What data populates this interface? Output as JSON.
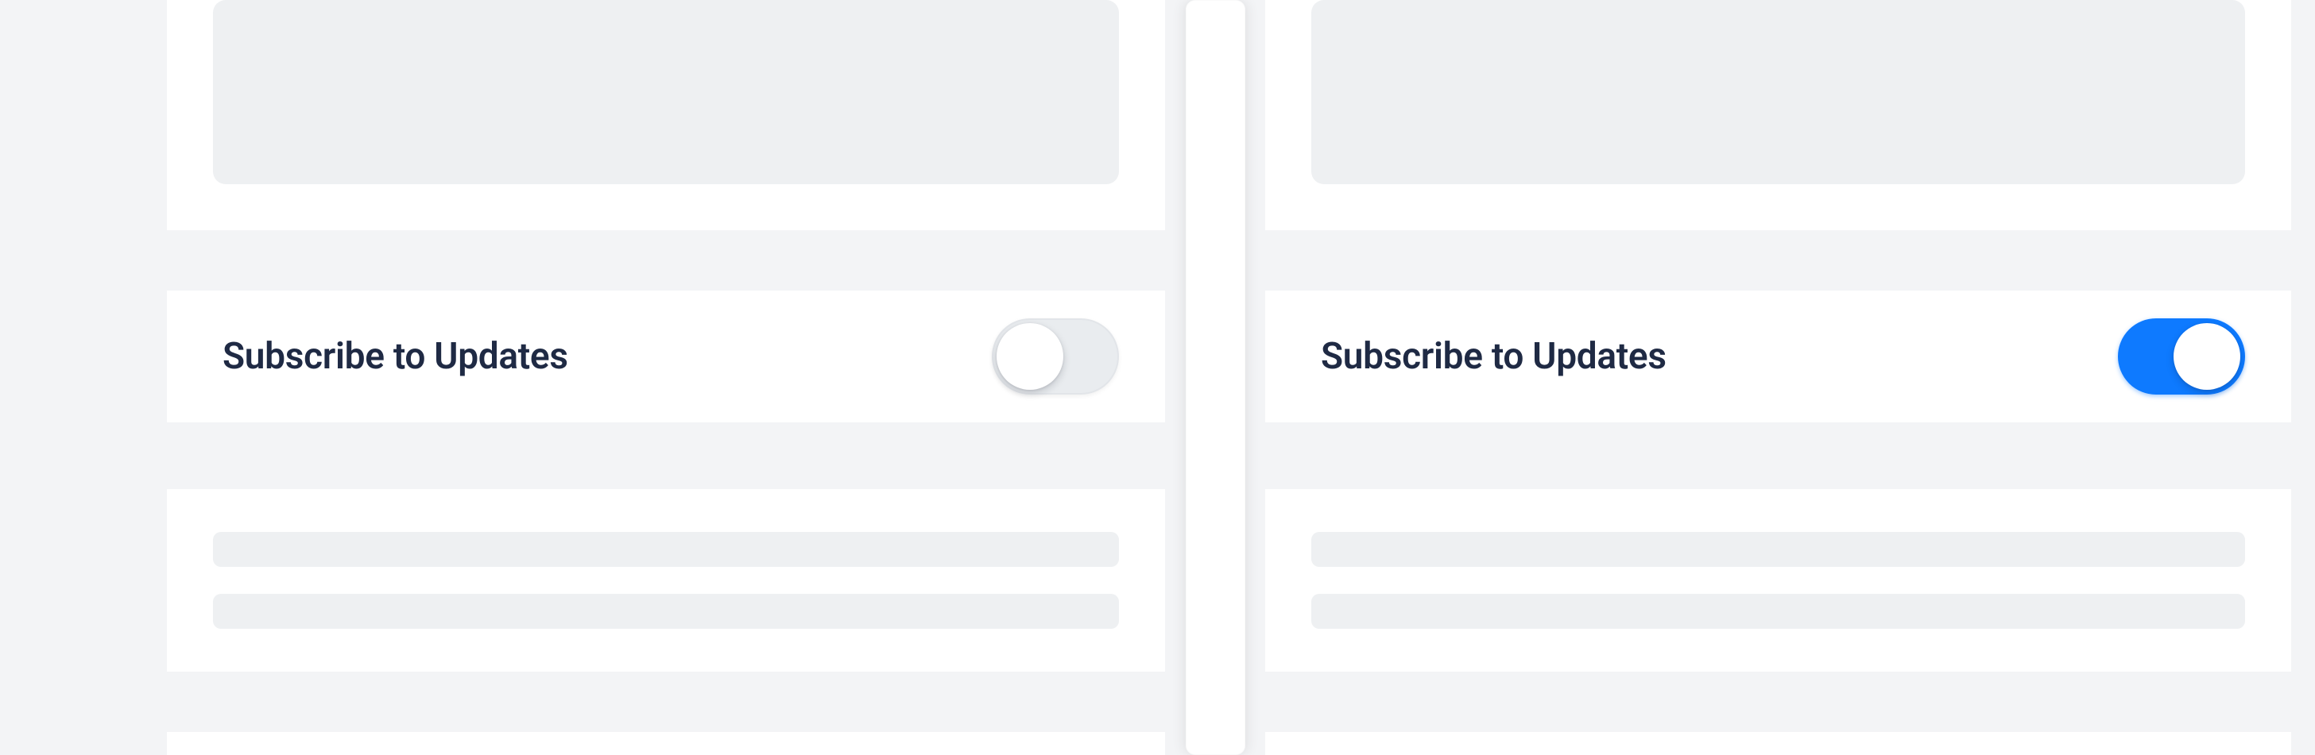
{
  "panels": {
    "left": {
      "subscribe_label": "Subscribe to Updates",
      "subscribe_on": false
    },
    "right": {
      "subscribe_label": "Subscribe to Updates",
      "subscribe_on": true
    }
  },
  "colors": {
    "toggle_on": "#0e7aff",
    "toggle_off_track": "#e9ecef",
    "page_bg": "#f3f4f6",
    "card_bg": "#ffffff",
    "placeholder": "#eef0f2",
    "label_text": "#1f2a44"
  }
}
